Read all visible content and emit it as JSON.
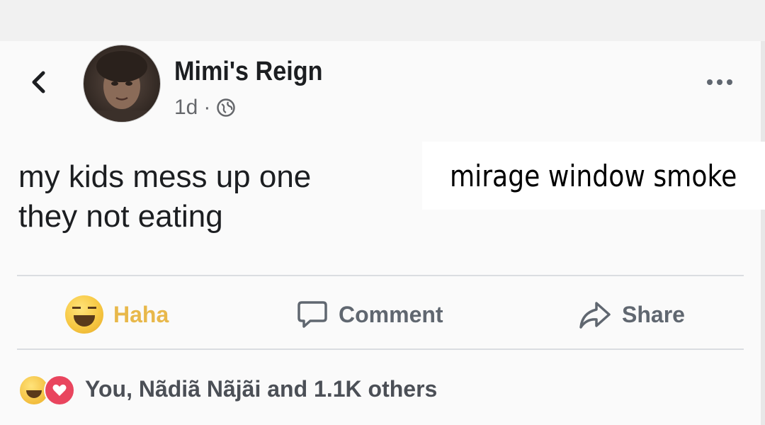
{
  "post": {
    "author": "Mimi's Reign",
    "time": "1d",
    "separator": "·",
    "privacy_icon": "globe-icon",
    "text_line1": "my kids mess up one",
    "text_line2": "they not eating",
    "overlay_caption": "mirage window smoke"
  },
  "actions": {
    "haha_label": "Haha",
    "comment_label": "Comment",
    "share_label": "Share"
  },
  "reactions": {
    "summary": "You, Nãdiã Nãjãi and 1.1K others",
    "icons": [
      "haha-icon",
      "love-icon"
    ]
  },
  "colors": {
    "haha_accent": "#e8b84a",
    "text_primary": "#1c1e21",
    "text_secondary": "#606770",
    "love_red": "#e9455e"
  }
}
